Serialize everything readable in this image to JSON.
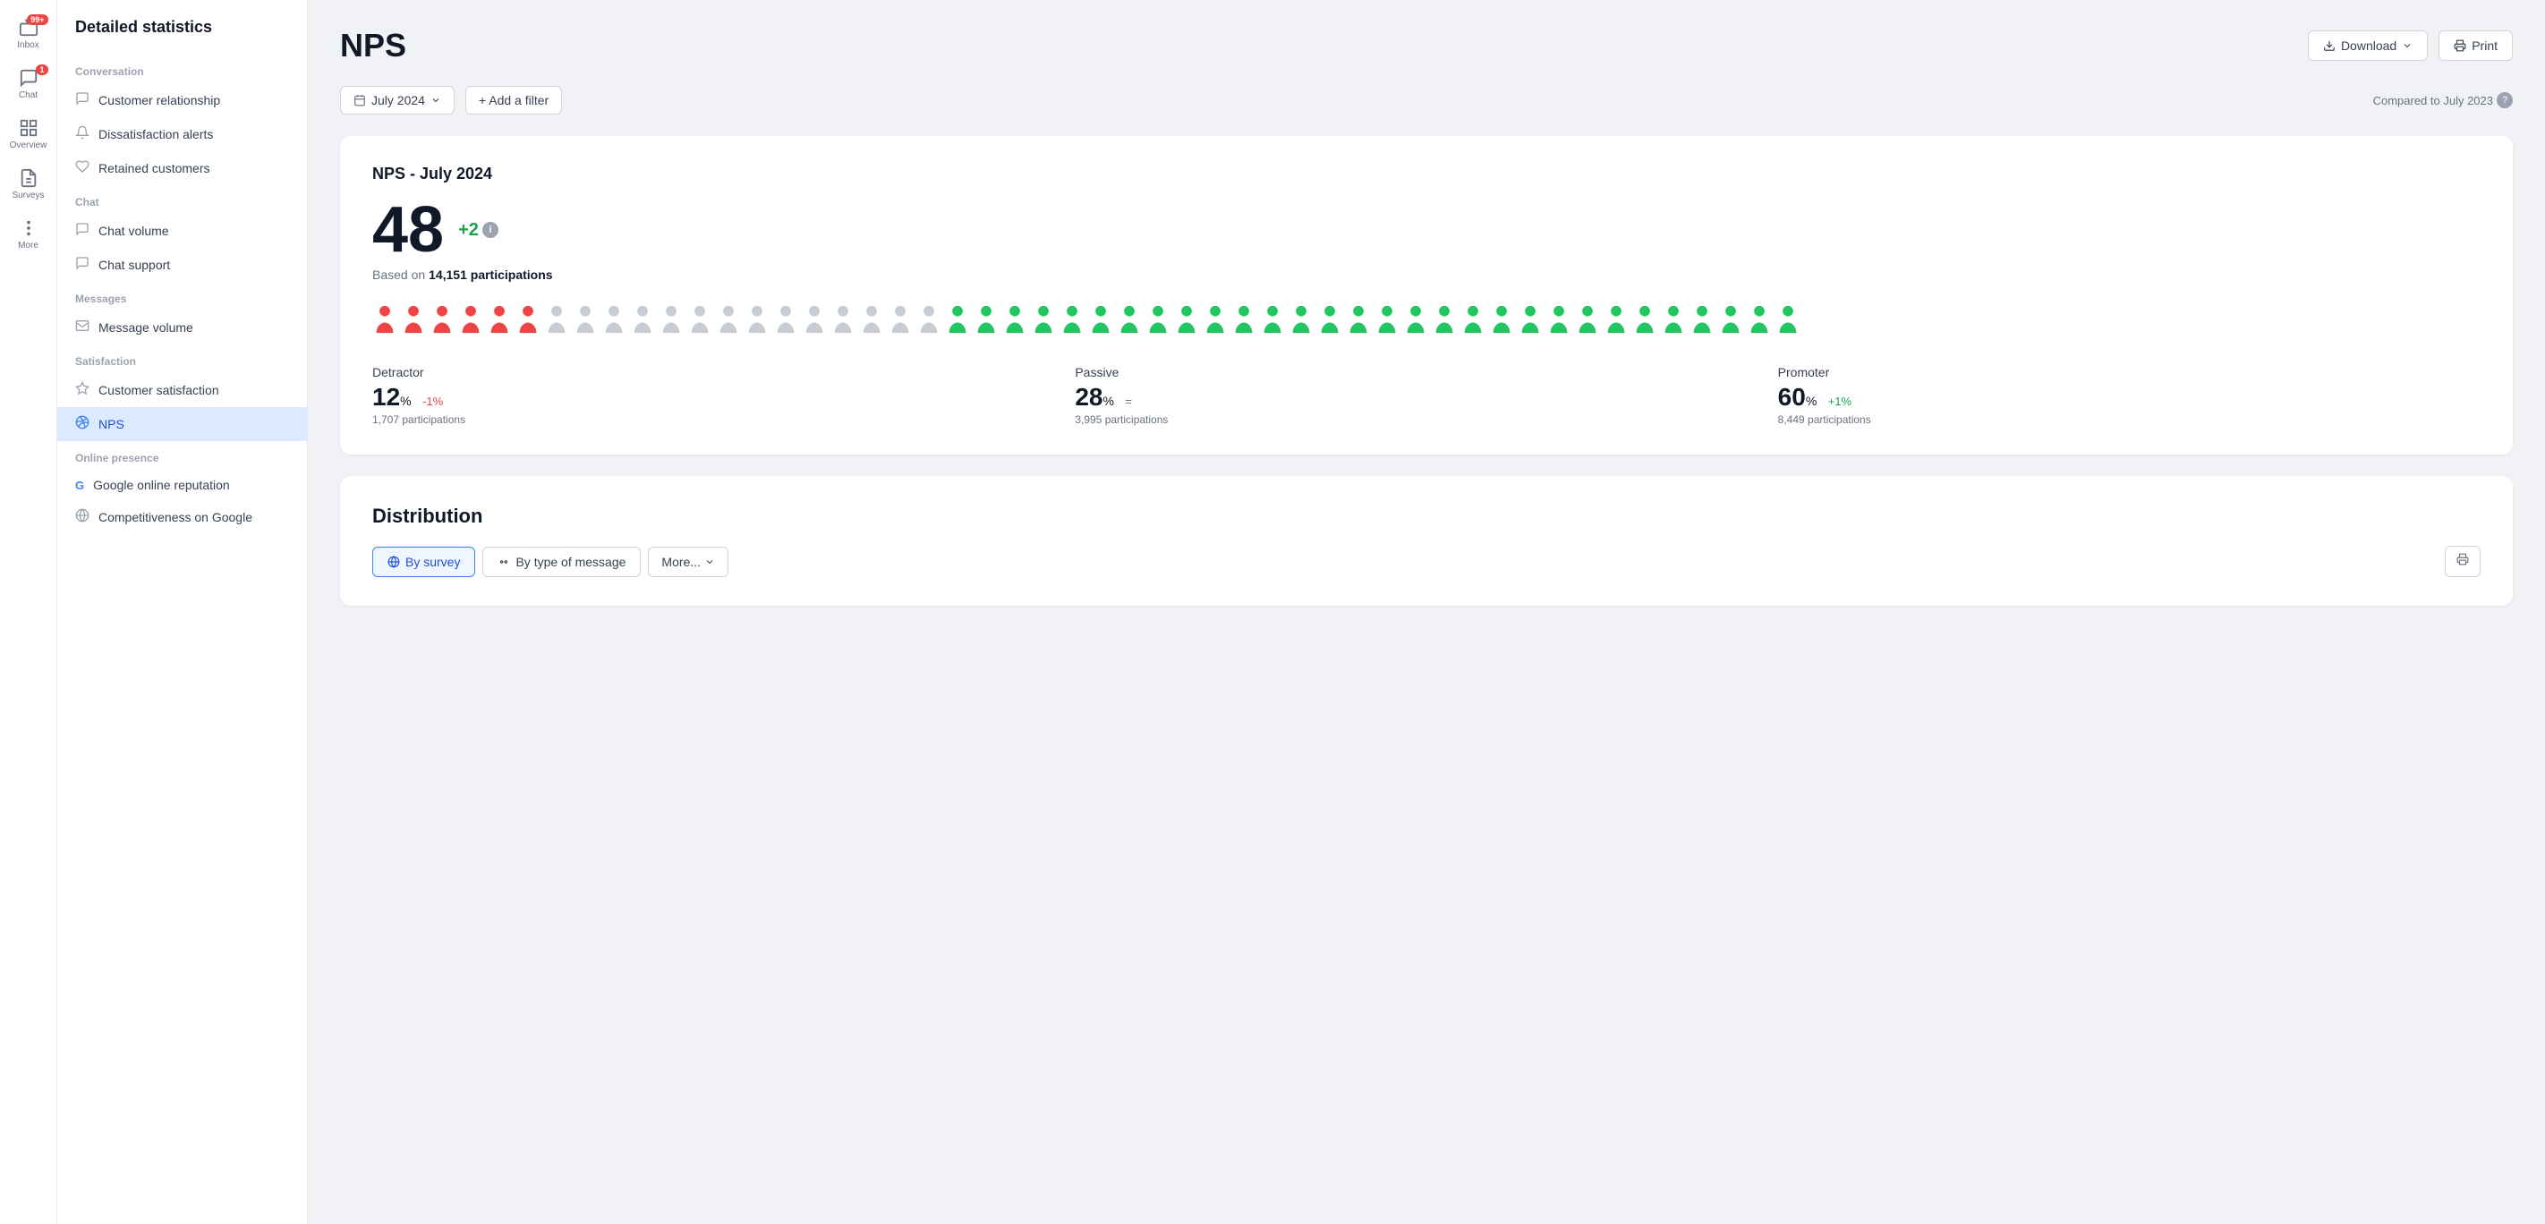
{
  "app": {
    "title": "Detailed statistics"
  },
  "icon_bar": {
    "items": [
      {
        "id": "inbox",
        "label": "Inbox",
        "badge": "99+"
      },
      {
        "id": "chat",
        "label": "Chat",
        "badge": "1"
      },
      {
        "id": "overview",
        "label": "Overview",
        "badge": null
      },
      {
        "id": "surveys",
        "label": "Surveys",
        "badge": null
      },
      {
        "id": "more",
        "label": "More",
        "badge": null
      }
    ]
  },
  "sidebar": {
    "title": "Detailed statistics",
    "sections": [
      {
        "label": "Conversation",
        "items": [
          {
            "id": "customer-relationship",
            "label": "Customer relationship",
            "icon": "💬",
            "active": false
          },
          {
            "id": "dissatisfaction-alerts",
            "label": "Dissatisfaction alerts",
            "icon": "🔔",
            "active": false
          },
          {
            "id": "retained-customers",
            "label": "Retained customers",
            "icon": "🤝",
            "active": false
          }
        ]
      },
      {
        "label": "Chat",
        "items": [
          {
            "id": "chat-volume",
            "label": "Chat volume",
            "icon": "💬",
            "active": false
          },
          {
            "id": "chat-support",
            "label": "Chat support",
            "icon": "💬",
            "active": false
          }
        ]
      },
      {
        "label": "Messages",
        "items": [
          {
            "id": "message-volume",
            "label": "Message volume",
            "icon": "✉️",
            "active": false
          }
        ]
      },
      {
        "label": "Satisfaction",
        "items": [
          {
            "id": "customer-satisfaction",
            "label": "Customer satisfaction",
            "icon": "⭐",
            "active": false
          },
          {
            "id": "nps",
            "label": "NPS",
            "icon": "📊",
            "active": true
          }
        ]
      },
      {
        "label": "Online presence",
        "items": [
          {
            "id": "google-online-reputation",
            "label": "Google online reputation",
            "icon": "G",
            "active": false
          },
          {
            "id": "competitiveness-on-google",
            "label": "Competitiveness on Google",
            "icon": "🌐",
            "active": false
          }
        ]
      }
    ]
  },
  "header": {
    "page_title": "NPS",
    "download_label": "Download",
    "print_label": "Print"
  },
  "filter_bar": {
    "date_label": "July 2024",
    "add_filter_label": "+ Add a filter",
    "compared_label": "Compared to July 2023"
  },
  "nps_card": {
    "title": "NPS - July 2024",
    "score": "48",
    "change": "+2",
    "participations_prefix": "Based on",
    "participations_value": "14,151 participations",
    "detractor": {
      "label": "Detractor",
      "pct": "12",
      "change": "-1%",
      "change_type": "neg",
      "participations": "1,707 participations"
    },
    "passive": {
      "label": "Passive",
      "pct": "28",
      "change": "=",
      "change_type": "neutral",
      "participations": "3,995 participations"
    },
    "promoter": {
      "label": "Promoter",
      "pct": "60",
      "change": "+1%",
      "change_type": "pos",
      "participations": "8,449 participations"
    }
  },
  "distribution": {
    "title": "Distribution",
    "tabs": [
      {
        "id": "by-survey",
        "label": "By survey",
        "active": true
      },
      {
        "id": "by-type-of-message",
        "label": "By type of message",
        "active": false
      }
    ],
    "more_label": "More...",
    "people": {
      "red_count": 6,
      "gray_count": 14,
      "green_count": 30
    }
  }
}
